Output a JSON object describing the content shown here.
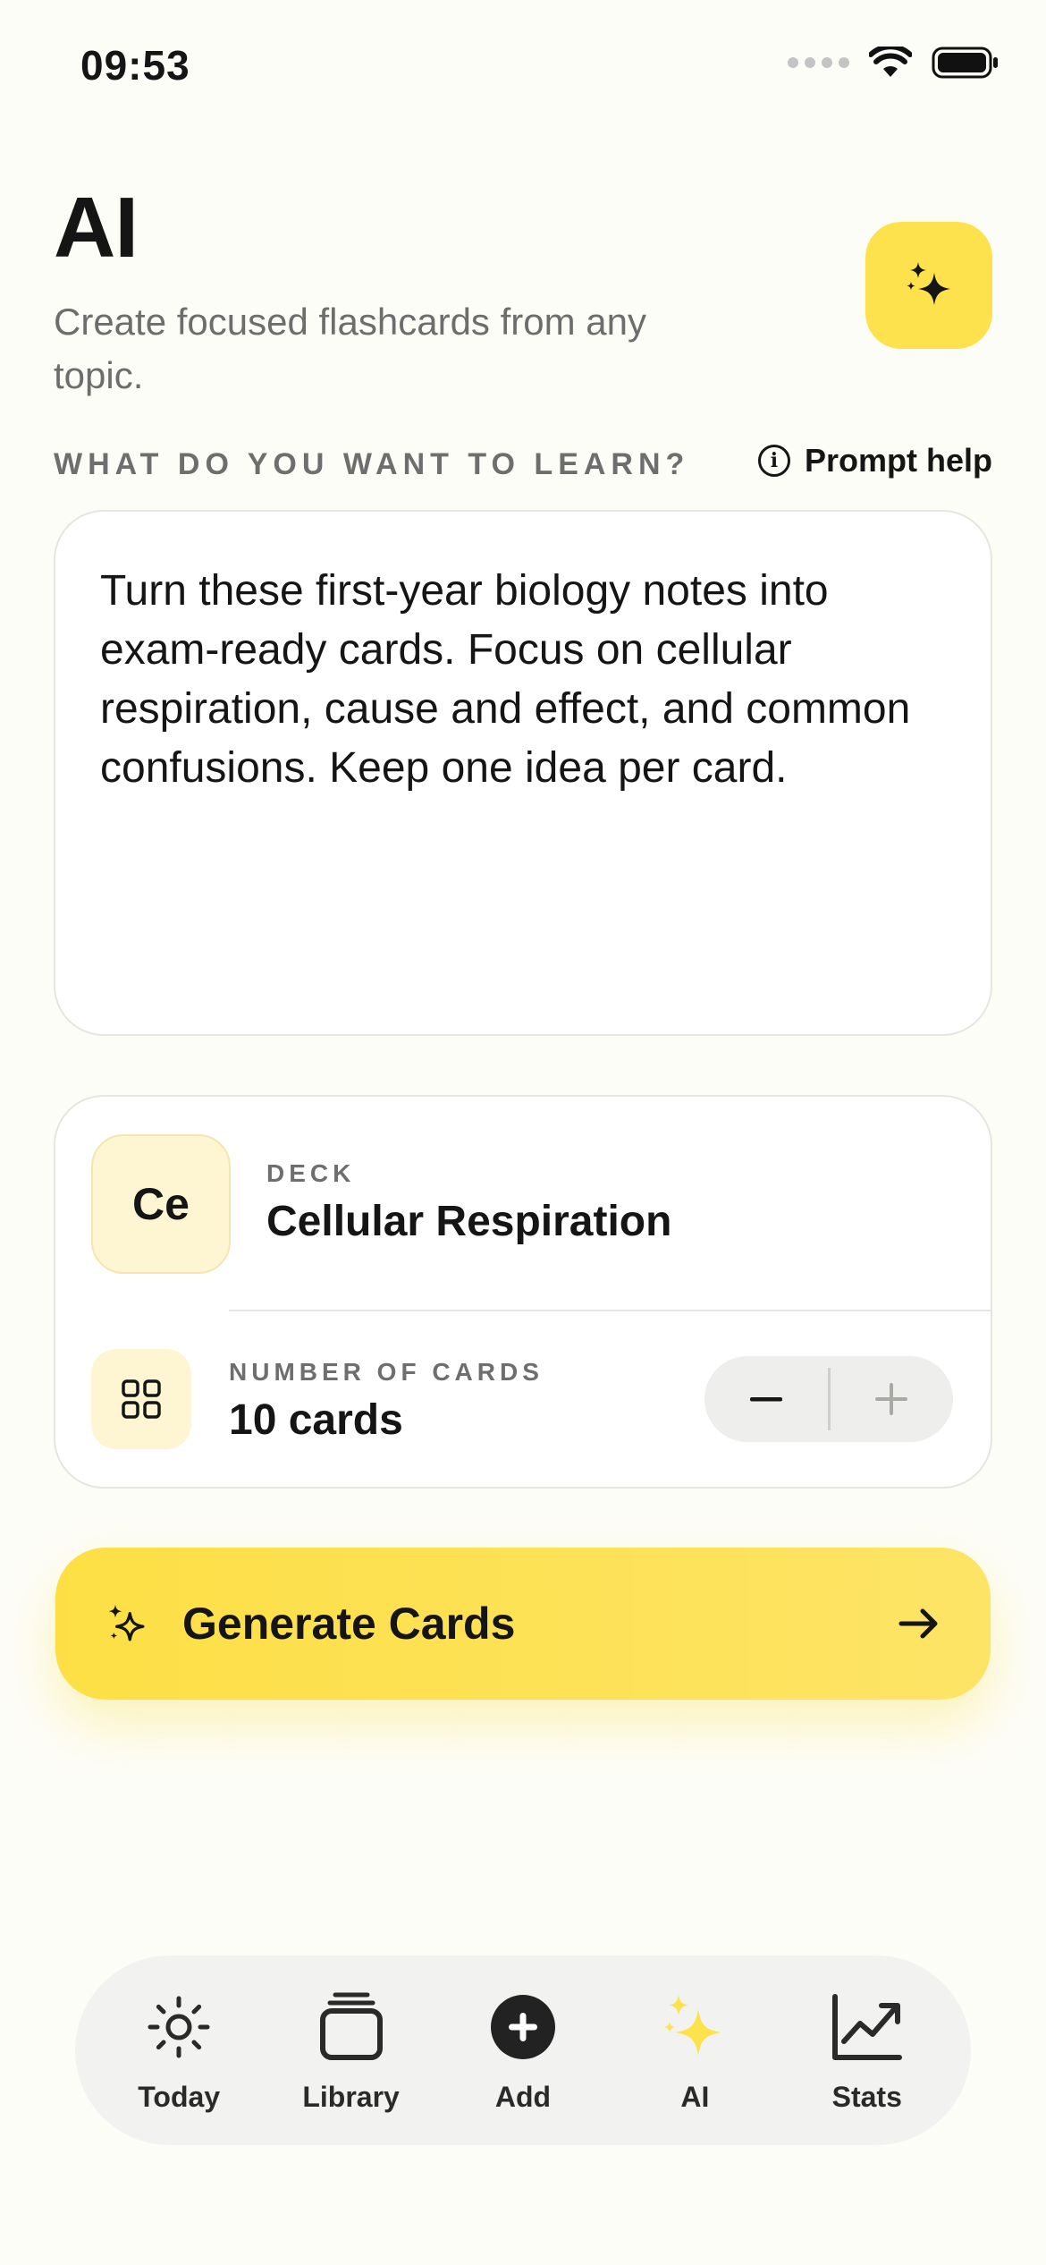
{
  "status_bar": {
    "time": "09:53"
  },
  "header": {
    "title": "AI",
    "subtitle": "Create focused flashcards from any topic."
  },
  "prompt_section": {
    "label": "WHAT DO YOU WANT TO LEARN?",
    "help_label": "Prompt help",
    "prompt_value": "Turn these first-year biology notes into exam-ready cards. Focus on cellular respiration, cause and effect, and common confusions. Keep one idea per card."
  },
  "deck": {
    "avatar_initials": "Ce",
    "label": "DECK",
    "name": "Cellular Respiration"
  },
  "card_count": {
    "label": "NUMBER OF CARDS",
    "value": "10 cards",
    "count": 10
  },
  "generate_button": {
    "label": "Generate Cards"
  },
  "tab_bar": {
    "active_tab": "AI",
    "items": [
      {
        "label": "Today",
        "icon": "sun-icon"
      },
      {
        "label": "Library",
        "icon": "stack-icon"
      },
      {
        "label": "Add",
        "icon": "plus-circle-icon"
      },
      {
        "label": "AI",
        "icon": "sparkles-icon"
      },
      {
        "label": "Stats",
        "icon": "chart-line-icon"
      }
    ]
  },
  "colors": {
    "accent": "#FDE24D",
    "background": "#FDFDF8",
    "deck_tint": "#FEF6D3"
  }
}
